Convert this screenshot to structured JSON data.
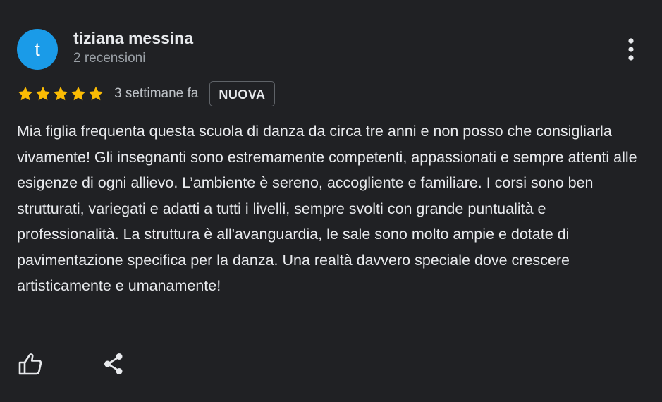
{
  "review": {
    "author_initial": "t",
    "author_name": "tiziana messina",
    "author_meta": "2 recensioni",
    "rating": 5,
    "rating_max": 5,
    "star_color": "#fbbc04",
    "avatar_color": "#1a9be8",
    "time": "3 settimane fa",
    "badge": "NUOVA",
    "text": "Mia figlia frequenta questa scuola di danza da circa tre anni e non posso che consigliarla vivamente! Gli insegnanti sono estremamente competenti, appassionati e sempre attenti alle esigenze di ogni allievo. L’ambiente è sereno, accogliente e familiare. I corsi sono ben strutturati, variegati e adatti a tutti i livelli, sempre svolti con grande puntualità e professionalità. La struttura è all'avanguardia, le sale sono molto ampie e dotate di pavimentazione specifica per la danza. Una realtà davvero speciale dove crescere artisticamente e umanamente!"
  },
  "icons": {
    "more": "more-vert-icon",
    "like": "thumb-up-icon",
    "share": "share-icon",
    "star": "star-icon"
  }
}
